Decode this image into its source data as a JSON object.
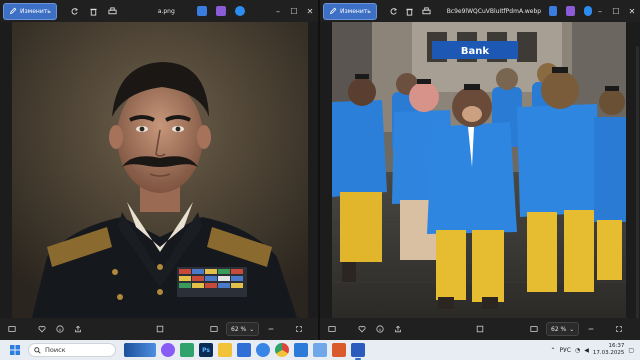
{
  "left_window": {
    "edit_label": "Изменить",
    "filename": "a.png",
    "zoom": "62 %"
  },
  "right_window": {
    "edit_label": "Изменить",
    "filename": "Bc9e9lWQCuVBluItfPdmA.webp",
    "zoom": "62 %",
    "photo_sign": "Bank"
  },
  "taskbar": {
    "search_placeholder": "Поиск",
    "language": "РУС",
    "time": "16:37",
    "date": "17.03.2025",
    "apps": [
      {
        "name": "widgets-icon",
        "color": "#3b77d6"
      },
      {
        "name": "copilot-icon",
        "color": "#8a5cf6"
      },
      {
        "name": "photos-icon",
        "color": "#2fa36b"
      },
      {
        "name": "photoshop-icon",
        "color": "#0b2c54",
        "label": "Ps"
      },
      {
        "name": "file-explorer-icon",
        "color": "#f3c23b"
      },
      {
        "name": "store-icon",
        "color": "#2f6fd6"
      },
      {
        "name": "browser-icon",
        "color": "#3a86e6"
      },
      {
        "name": "chrome-icon",
        "color": "#e0453a"
      },
      {
        "name": "mail-icon",
        "color": "#2c7bd8"
      },
      {
        "name": "images-app-icon",
        "color": "#6fa7e8"
      },
      {
        "name": "app-icon",
        "color": "#d95b2b"
      },
      {
        "name": "photos-viewer-icon",
        "color": "#2a5bbd"
      }
    ]
  }
}
